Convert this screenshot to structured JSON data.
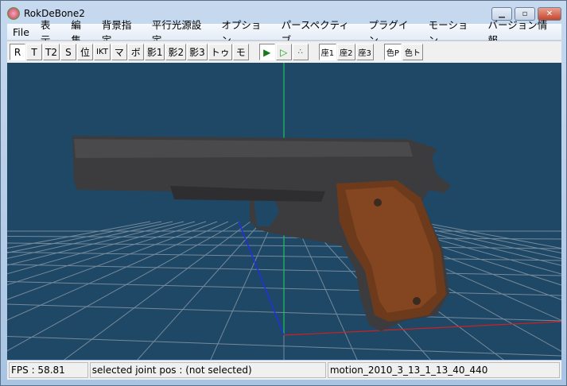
{
  "window": {
    "title": "RokDeBone2",
    "controls": [
      "minimize",
      "maximize",
      "close"
    ]
  },
  "menu": [
    "File",
    "表示",
    "編集",
    "背景指定",
    "平行光源設定",
    "オプション",
    "パースペクティブ",
    "プラグイン",
    "モーション",
    "バージョン情報"
  ],
  "toolbar": {
    "group1": [
      "R",
      "T",
      "T2",
      "S",
      "位",
      "IKT",
      "マ",
      "ボ",
      "影1",
      "影2",
      "影3",
      "トゥ",
      "モ"
    ],
    "group2_icons": [
      "select-filled-triangle-icon",
      "select-outline-triangle-icon",
      "points-icon"
    ],
    "group3": [
      "座1",
      "座2",
      "座3"
    ],
    "group4": [
      "色P",
      "色ト"
    ]
  },
  "status": {
    "fps": "FPS : 58.81",
    "joint": "selected joint pos : (not selected)",
    "motion": "motion_2010_3_13_1_13_40_440"
  },
  "colors": {
    "viewport_bg": "#1e4866",
    "grid": "#8a9aa8",
    "y_axis": "#22c05a",
    "x_axis": "#d02020",
    "z_axis": "#2030e0"
  }
}
